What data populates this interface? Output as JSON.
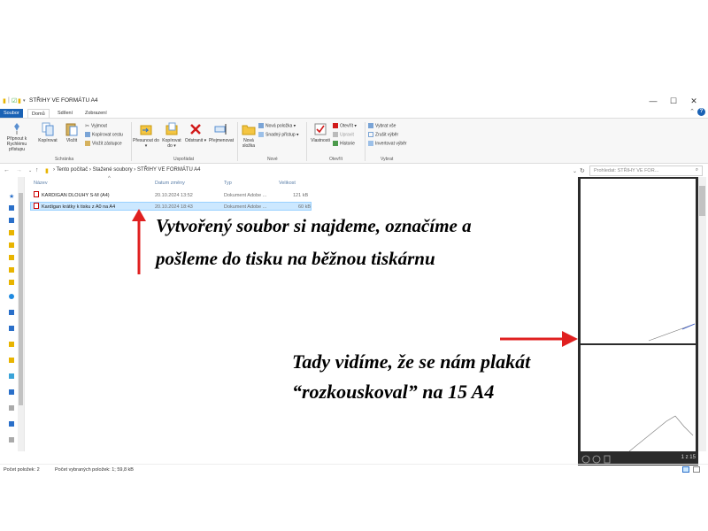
{
  "window": {
    "title": "STŘIHY VE FORMÁTU A4",
    "controls": {
      "minimize": "—",
      "maximize": "☐",
      "close": "✕"
    }
  },
  "tabs": [
    "Soubor",
    "Domů",
    "Sdílení",
    "Zobrazení"
  ],
  "ribbon": {
    "clipboard": {
      "pin": "Připnout k Rychlému přístupu",
      "copy": "Kopírovat",
      "paste": "Vložit",
      "cut": "Vyjmout",
      "copy_path": "Kopírovat cestu",
      "paste_shortcut": "Vložit zástupce",
      "label": "Schránka"
    },
    "organize": {
      "move_to": "Přesunout do ▾",
      "copy_to": "Kopírovat do ▾",
      "delete": "Odstranit ▾",
      "rename": "Přejmenovat",
      "label": "Uspořádat"
    },
    "new": {
      "new_folder": "Nová složka",
      "new_item": "Nová položka ▾",
      "easy_access": "Snadný přístup ▾",
      "label": "Nové"
    },
    "open": {
      "properties": "Vlastnosti",
      "open": "Otevřít ▾",
      "edit": "Upravit",
      "history": "Historie",
      "label": "Otevřít"
    },
    "select": {
      "select_all": "Vybrat vše",
      "select_none": "Zrušit výběr",
      "invert": "Invertovat výběr",
      "label": "Vybrat"
    }
  },
  "address": {
    "crumbs": "›  Tento počítač  ›  Stažené soubory  ›  STŘIHY VE FORMÁTU A4",
    "search_placeholder": "Prohledat: STŘIHY VE FOR..."
  },
  "columns": {
    "name": "Název",
    "date": "Datum změny",
    "type": "Typ",
    "size": "Velikost"
  },
  "files": [
    {
      "name": "KARDIGAN DLOUHY S-M (A4)",
      "date": "20.10.2024 13:52",
      "type": "Dokument Adobe ...",
      "size": "121 kB"
    },
    {
      "name": "Kardigan krátky k tisku z A0 na A4",
      "date": "20.10.2024 18:43",
      "type": "Dokument Adobe ...",
      "size": "60 kB"
    }
  ],
  "status": {
    "count": "Počet položek: 2",
    "selected": "Počet vybraných položek: 1; 59,8 kB"
  },
  "preview": {
    "page": "1 z 15"
  },
  "annotations": {
    "line1": "Vytvořený soubor si najdeme, označíme a",
    "line2": "pošleme do tisku na běžnou tiskárnu",
    "line3": "Tady vidíme, že se nám plakát",
    "line4": "“rozkouskoval” na 15 A4"
  },
  "colors": {
    "accent": "#1a62b5",
    "arrow": "#e02020",
    "selection": "#cce8ff"
  }
}
